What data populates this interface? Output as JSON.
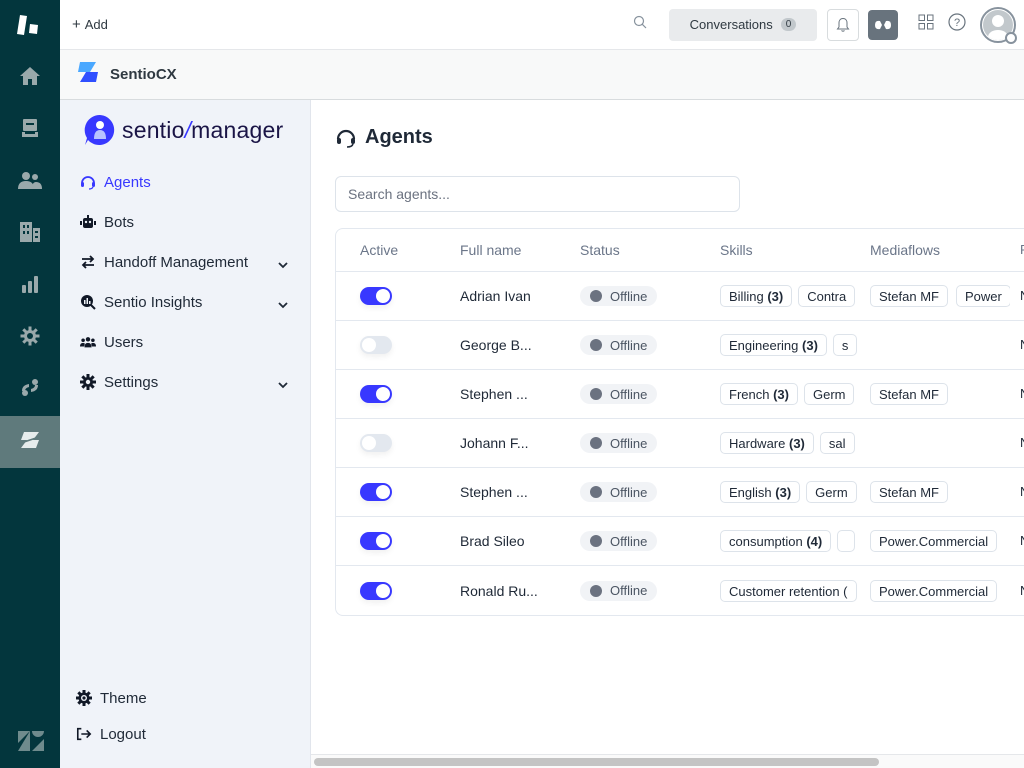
{
  "rail": {
    "items": [
      {
        "name": "home",
        "icon": "home-icon"
      },
      {
        "name": "views",
        "icon": "inbox-icon"
      },
      {
        "name": "customers",
        "icon": "users-icon"
      },
      {
        "name": "organizations",
        "icon": "building-icon"
      },
      {
        "name": "reporting",
        "icon": "bar-chart-icon"
      },
      {
        "name": "admin",
        "icon": "gear-icon"
      },
      {
        "name": "integration",
        "icon": "integration-icon"
      },
      {
        "name": "sentiocx",
        "icon": "sentio-icon",
        "active": true
      }
    ]
  },
  "topbar": {
    "add_label": "Add",
    "conversations_label": "Conversations",
    "conversations_count": "0"
  },
  "appbar": {
    "app_name": "SentioCX"
  },
  "sidebar": {
    "brand_part1": "sentio",
    "brand_slash": "/",
    "brand_part2": "manager",
    "items": [
      {
        "label": "Agents",
        "icon": "headset-icon",
        "active": true
      },
      {
        "label": "Bots",
        "icon": "robot-icon"
      },
      {
        "label": "Handoff Management",
        "icon": "arrows-exchange-icon",
        "expandable": true
      },
      {
        "label": "Sentio Insights",
        "icon": "insights-search-icon",
        "expandable": true
      },
      {
        "label": "Users",
        "icon": "users-group-icon"
      },
      {
        "label": "Settings",
        "icon": "gear-icon",
        "expandable": true
      }
    ],
    "bottom": [
      {
        "label": "Theme",
        "icon": "theme-gear-icon"
      },
      {
        "label": "Logout",
        "icon": "logout-icon"
      }
    ]
  },
  "main": {
    "title": "Agents",
    "search_placeholder": "Search agents...",
    "columns": [
      "Active",
      "Full name",
      "Status",
      "Skills",
      "Mediaflows",
      "P A"
    ],
    "rows": [
      {
        "active": true,
        "name": "Adrian Ivan",
        "status": "Offline",
        "skills": [
          {
            "label": "Billing",
            "count": "(3)"
          },
          {
            "label": "Contra",
            "count": ""
          }
        ],
        "mediaflows": [
          "Stefan MF",
          "Power"
        ],
        "extra": "N"
      },
      {
        "active": false,
        "name": "George B...",
        "status": "Offline",
        "skills": [
          {
            "label": "Engineering",
            "count": "(3)"
          },
          {
            "label": "s",
            "count": ""
          }
        ],
        "mediaflows": [],
        "extra": "N"
      },
      {
        "active": true,
        "name": "Stephen ...",
        "status": "Offline",
        "skills": [
          {
            "label": "French",
            "count": "(3)"
          },
          {
            "label": "Germ",
            "count": ""
          }
        ],
        "mediaflows": [
          "Stefan MF"
        ],
        "extra": "N"
      },
      {
        "active": false,
        "name": "Johann F...",
        "status": "Offline",
        "skills": [
          {
            "label": "Hardware",
            "count": "(3)"
          },
          {
            "label": "sal",
            "count": ""
          }
        ],
        "mediaflows": [],
        "extra": "N"
      },
      {
        "active": true,
        "name": "Stephen ...",
        "status": "Offline",
        "skills": [
          {
            "label": "English",
            "count": "(3)"
          },
          {
            "label": "Germ",
            "count": ""
          }
        ],
        "mediaflows": [
          "Stefan MF"
        ],
        "extra": "N"
      },
      {
        "active": true,
        "name": "Brad Sileo",
        "status": "Offline",
        "skills": [
          {
            "label": "consumption",
            "count": "(4)"
          },
          {
            "label": "",
            "count": ""
          }
        ],
        "mediaflows": [
          "Power.Commercial"
        ],
        "extra": "N"
      },
      {
        "active": true,
        "name": "Ronald Ru...",
        "status": "Offline",
        "skills": [
          {
            "label": "Customer retention (",
            "count": ""
          }
        ],
        "mediaflows": [
          "Power.Commercial"
        ],
        "extra": "N"
      }
    ]
  },
  "colors": {
    "rail_bg": "#03363d",
    "accent": "#3838ff",
    "status_offline": "#6b7280"
  }
}
